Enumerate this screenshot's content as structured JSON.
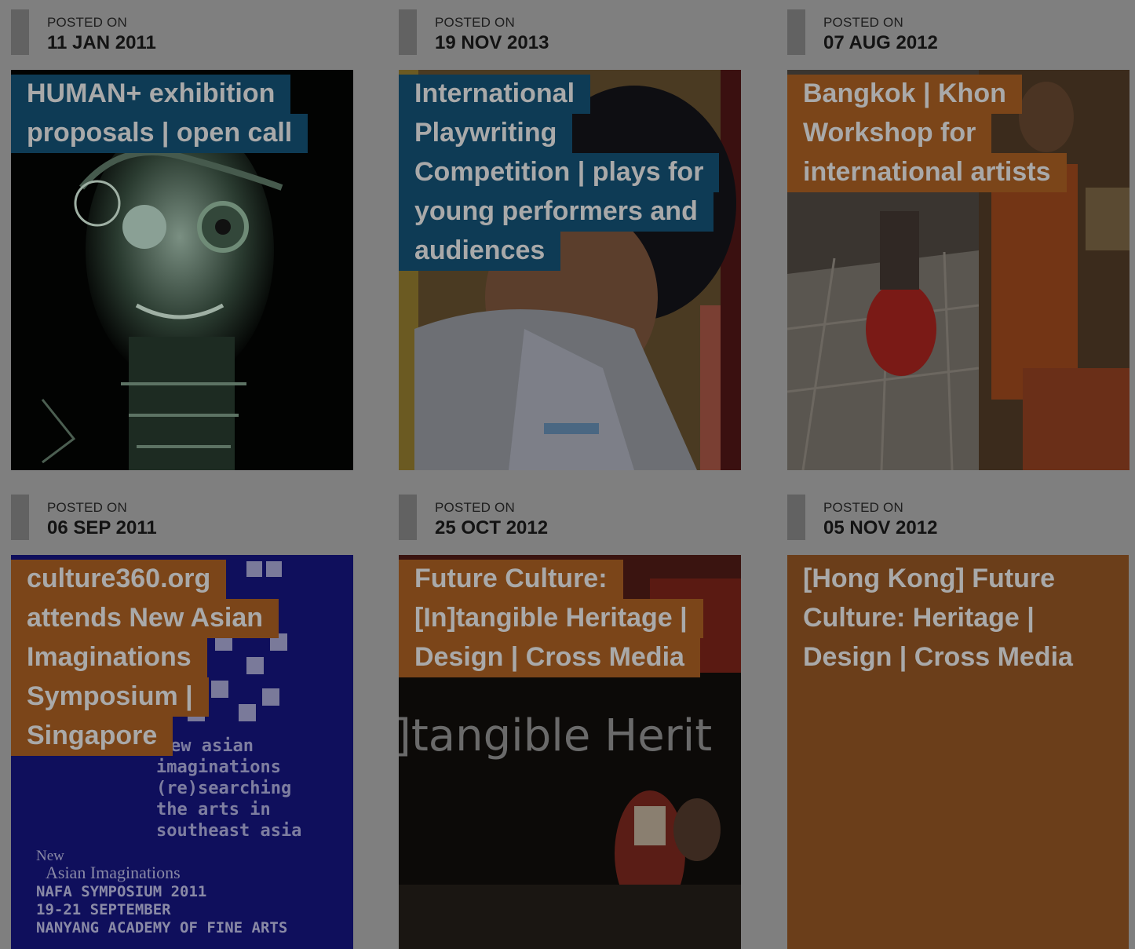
{
  "posted_label": "POSTED ON",
  "posts": [
    {
      "date": "11 JAN 2011",
      "title_lines": [
        "HUMAN+ exhibition",
        "proposals | open call"
      ],
      "color": "#0e3b55",
      "thumb": "cyborg-face-art"
    },
    {
      "date": "19 NOV 2013",
      "title_lines": [
        "International",
        "Playwriting",
        "Competition | plays for",
        "young performers and",
        "audiences"
      ],
      "color": "#0e3b55",
      "thumb": "child-photo"
    },
    {
      "date": "07 AUG 2012",
      "title_lines": [
        "Bangkok | Khon",
        "Workshop for",
        "international artists"
      ],
      "color": "#7b4519",
      "thumb": "dance-workshop-photo"
    },
    {
      "date": "06 SEP 2011",
      "title_lines": [
        "culture360.org",
        "attends New Asian",
        "Imaginations",
        "Symposium |",
        "Singapore"
      ],
      "color": "#7b4519",
      "thumb": "symposium-poster",
      "poster_lines": [
        "ew asian",
        "imaginations",
        "(re)searching",
        "the arts in",
        "southeast asia"
      ],
      "poster_footer": [
        "New",
        "Asian Imaginations",
        "NAFA SYMPOSIUM 2011",
        "19-21 SEPTEMBER",
        "NANYANG ACADEMY OF FINE ARTS"
      ]
    },
    {
      "date": "25 OCT 2012",
      "title_lines": [
        "Future Culture:",
        "[In]tangible Heritage |",
        "Design | Cross Media"
      ],
      "color": "#7b4519",
      "thumb": "heritage-stage-photo",
      "image_text": "]tangible Herit"
    },
    {
      "date": "05 NOV 2012",
      "title_lines": [
        "[Hong Kong] Future",
        "Culture: Heritage |",
        "Design | Cross Media"
      ],
      "color": "#7b4519",
      "thumb": "none"
    }
  ]
}
